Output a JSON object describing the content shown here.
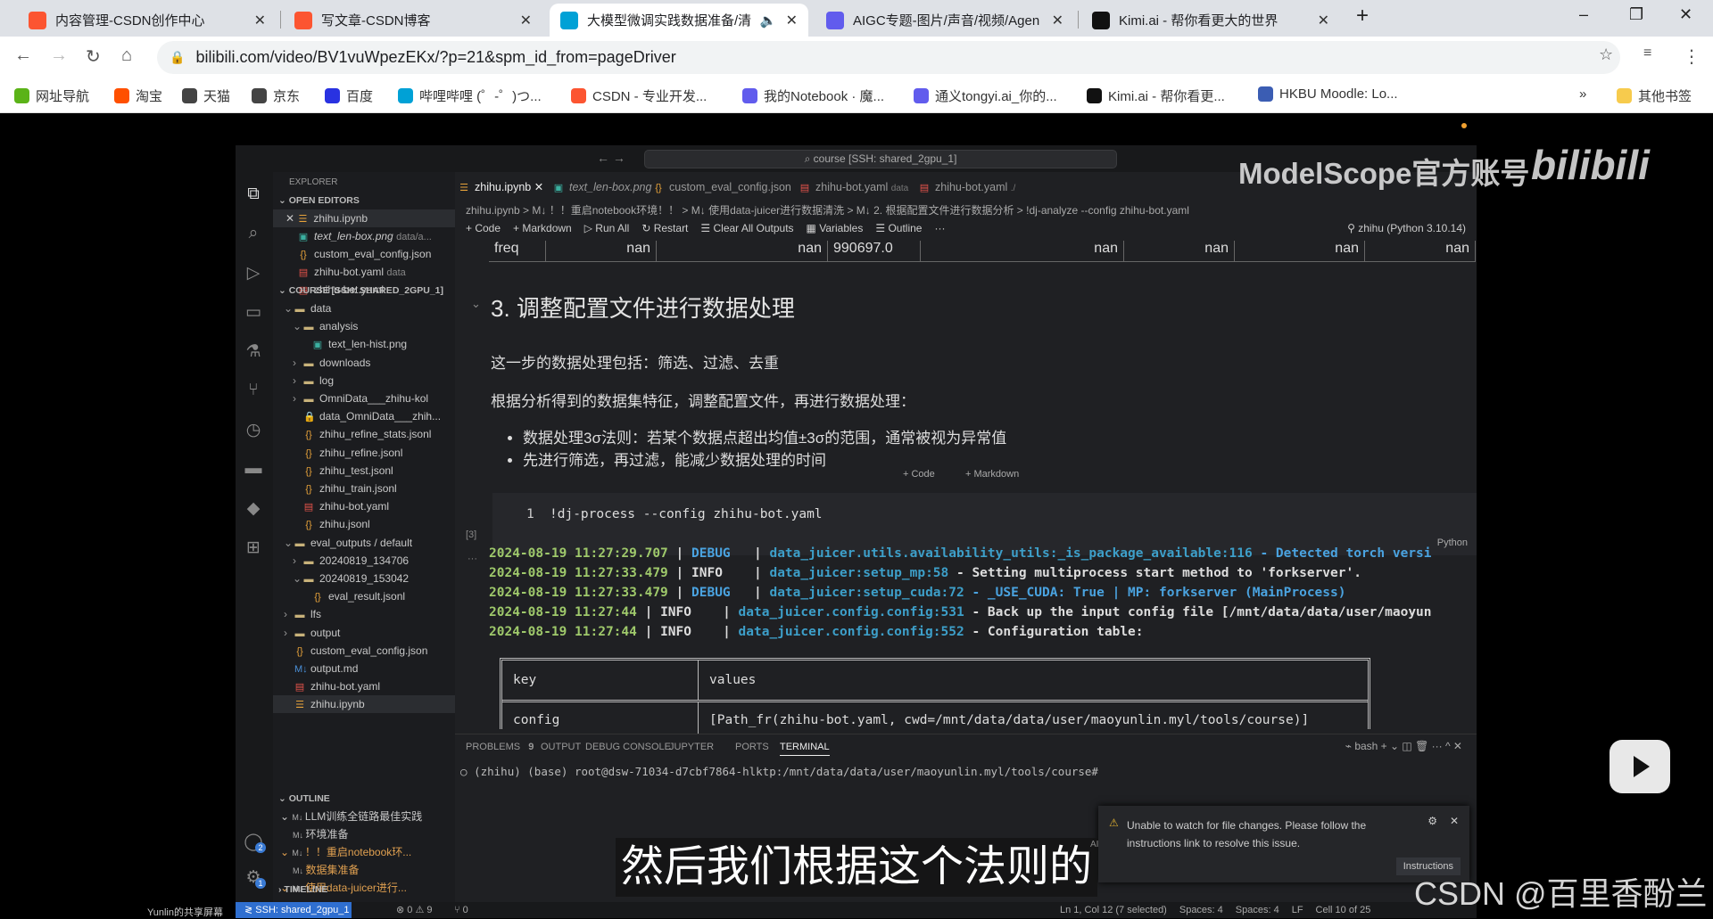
{
  "browser": {
    "tabs": [
      {
        "title": "内容管理-CSDN创作中心",
        "icon": "csdn-icon",
        "color": "#fc5531"
      },
      {
        "title": "写文章-CSDN博客",
        "icon": "csdn-icon",
        "color": "#fc5531"
      },
      {
        "title": "大模型微调实践数据准备/清",
        "icon": "bilibili-icon",
        "color": "#00a1d6",
        "active": true
      },
      {
        "title": "AIGC专题-图片/声音/视频/Agen",
        "icon": "notebook-icon",
        "color": "#615ced"
      },
      {
        "title": "Kimi.ai - 帮你看更大的世界",
        "icon": "kimi-icon",
        "color": "#111"
      }
    ],
    "url": "bilibili.com/video/BV1vuWpezEKx/?p=21&spm_id_from=pageDriver",
    "bookmarks": [
      "网址导航",
      "淘宝",
      "天猫",
      "京东",
      "百度",
      "哔哩哔哩 (゜-゜)つ...",
      "CSDN - 专业开发...",
      "我的Notebook · 魔...",
      "通义tongyi.ai_你的...",
      "Kimi.ai - 帮你看更...",
      "HKBU Moodle: Lo..."
    ],
    "other_bookmarks": "其他书签",
    "more": "»"
  },
  "vscode": {
    "search": "course [SSH: shared_2gpu_1]",
    "explorer_title": "EXPLORER",
    "open_editors_label": "OPEN EDITORS",
    "open_editors": [
      {
        "name": "zhihu.ipynb",
        "icon": "notebook",
        "sel": true
      },
      {
        "name": "text_len-box.png",
        "hint": "data/a...",
        "icon": "image"
      },
      {
        "name": "custom_eval_config.json",
        "icon": "json"
      },
      {
        "name": "zhihu-bot.yaml",
        "hint": "data",
        "icon": "yaml"
      },
      {
        "name": "zhihu-bot.yaml",
        "icon": "yaml"
      }
    ],
    "workspace_label": "COURSE [SSH: SHARED_2GPU_1]",
    "tree": [
      {
        "name": "data",
        "d": 1,
        "chev": "v",
        "icon": "folder"
      },
      {
        "name": "analysis",
        "d": 2,
        "chev": "v",
        "icon": "folder"
      },
      {
        "name": "text_len-hist.png",
        "d": 3,
        "icon": "image"
      },
      {
        "name": "downloads",
        "d": 2,
        "chev": ">",
        "icon": "folder"
      },
      {
        "name": "log",
        "d": 2,
        "chev": ">",
        "icon": "folder"
      },
      {
        "name": "OmniData___zhihu-kol",
        "d": 2,
        "chev": ">",
        "icon": "folder"
      },
      {
        "name": "data_OmniData___zhih...",
        "d": 2,
        "icon": "lock"
      },
      {
        "name": "zhihu_refine_stats.jsonl",
        "d": 2,
        "icon": "json"
      },
      {
        "name": "zhihu_refine.jsonl",
        "d": 2,
        "icon": "json"
      },
      {
        "name": "zhihu_test.jsonl",
        "d": 2,
        "icon": "json"
      },
      {
        "name": "zhihu_train.jsonl",
        "d": 2,
        "icon": "json"
      },
      {
        "name": "zhihu-bot.yaml",
        "d": 2,
        "icon": "yaml"
      },
      {
        "name": "zhihu.jsonl",
        "d": 2,
        "icon": "json"
      },
      {
        "name": "eval_outputs / default",
        "d": 1,
        "chev": "v",
        "icon": "folder"
      },
      {
        "name": "20240819_134706",
        "d": 2,
        "chev": ">",
        "icon": "folder"
      },
      {
        "name": "20240819_153042",
        "d": 2,
        "chev": "v",
        "icon": "folder"
      },
      {
        "name": "eval_result.jsonl",
        "d": 3,
        "icon": "json"
      },
      {
        "name": "lfs",
        "d": 1,
        "chev": ">",
        "icon": "folder"
      },
      {
        "name": "output",
        "d": 1,
        "chev": ">",
        "icon": "folder"
      },
      {
        "name": "custom_eval_config.json",
        "d": 1,
        "icon": "json"
      },
      {
        "name": "output.md",
        "d": 1,
        "icon": "md"
      },
      {
        "name": "zhihu-bot.yaml",
        "d": 1,
        "icon": "yaml"
      },
      {
        "name": "zhihu.ipynb",
        "d": 1,
        "icon": "notebook",
        "sel": true
      }
    ],
    "outline_label": "OUTLINE",
    "outline": [
      "LLM训练全链路最佳实践",
      "环境准备",
      "！！重启notebook环...",
      "数据集准备",
      "使用data-juicer进行..."
    ],
    "timeline_label": "TIMELINE",
    "editor_tabs": [
      {
        "name": "zhihu.ipynb",
        "icon": "notebook",
        "active": true
      },
      {
        "name": "text_len-box.png",
        "icon": "image"
      },
      {
        "name": "custom_eval_config.json",
        "icon": "json"
      },
      {
        "name": "zhihu-bot.yaml",
        "hint": "data",
        "icon": "yaml"
      },
      {
        "name": "zhihu-bot.yaml",
        "hint": "./",
        "icon": "yaml"
      }
    ],
    "breadcrumb": "zhihu.ipynb > M↓ ！！重启notebook环境！！ > M↓ 使用data-juicer进行数据清洗 > M↓ 2. 根据配置文件进行数据分析 > !dj-analyze --config zhihu-bot.yaml",
    "toolbar": [
      "+ Code",
      "+ Markdown",
      "▷ Run All",
      "↻ Restart",
      "☰ Clear All Outputs",
      "▦ Variables",
      "☰ Outline",
      "···"
    ],
    "kernel": "zhihu (Python 3.10.14)",
    "freq_row": [
      "freq",
      "nan",
      "nan",
      "990697.0",
      "nan",
      "nan",
      "nan",
      "nan"
    ],
    "heading": "3. 调整配置文件进行数据处理",
    "para1": "这一步的数据处理包括：筛选、过滤、去重",
    "para2": "根据分析得到的数据集特征，调整配置文件，再进行数据处理：",
    "bullets": [
      "数据处理3σ法则：若某个数据点超出均值±3σ的范围，通常被视为异常值",
      "先进行筛选，再过滤，能减少数据处理的时间"
    ],
    "add_code": "+ Code",
    "add_md": "+ Markdown",
    "cell_line": "1",
    "cell_code": "!dj-process --config zhihu-bot.yaml",
    "cell_index": "[3]",
    "cell_lang": "Python",
    "logs": [
      {
        "ts": "2024-08-19 11:27:29.707",
        "lvl": "DEBUG",
        "src": "data_juicer.utils.availability_utils:_is_package_available:116",
        "msg": " - Detected torch versi",
        "blue": true
      },
      {
        "ts": "2024-08-19 11:27:33.479",
        "lvl": "INFO",
        "src": "data_juicer:setup_mp:58",
        "msg": " - Setting multiprocess start method to 'forkserver'."
      },
      {
        "ts": "2024-08-19 11:27:33.479",
        "lvl": "DEBUG",
        "src": "data_juicer:setup_cuda:72",
        "msg": " - _USE_CUDA: True | MP: forkserver (MainProcess)",
        "blue": true
      },
      {
        "ts": "2024-08-19 11:27:44",
        "lvl": "INFO",
        "src": "data_juicer.config.config:531",
        "msg": " - Back up the input config file [/mnt/data/data/user/maoyun"
      },
      {
        "ts": "2024-08-19 11:27:44",
        "lvl": "INFO",
        "src": "data_juicer.config.config:552",
        "msg": " - Configuration table:"
      }
    ],
    "config_table": {
      "head": [
        "key",
        "values"
      ],
      "row": [
        "config",
        "[Path_fr(zhihu-bot.yaml, cwd=/mnt/data/data/user/maoyunlin.myl/tools/course)]"
      ]
    },
    "panel_tabs": [
      "PROBLEMS",
      "OUTPUT",
      "DEBUG CONSOLE",
      "JUPYTER",
      "PORTS",
      "TERMINAL"
    ],
    "problems_count": "9",
    "terminal_shell": "bash",
    "terminal_line": "(zhihu) (base) root@dsw-71034-d7cbf7864-hlktp:/mnt/data/data/user/maoyunlin.myl/tools/course#",
    "notification": {
      "text": "Unable to watch for file changes. Please follow the instructions link to resolve this issue.",
      "button": "Instructions"
    },
    "status": {
      "remote": "SSH: shared_2gpu_1",
      "errors": "⊗ 0 ⚠ 9",
      "ports": "⑂ 0",
      "position": "Ln 1, Col 12 (7 selected)",
      "spaces1": "Spaces: 4",
      "spaces2": "Spaces: 4",
      "eol": "LF",
      "cell": "Cell 10 of 25"
    },
    "accounts_badge": "2",
    "settings_badge": "1"
  },
  "video": {
    "subtitle": "然后我们根据这个法则的",
    "watermark": "ModelScope官方账号",
    "bili_logo": "bilibili",
    "csdn": "CSDN @百里香酚兰",
    "share_label": "Yunlin的共享屏幕",
    "ai_tag": "AI"
  }
}
